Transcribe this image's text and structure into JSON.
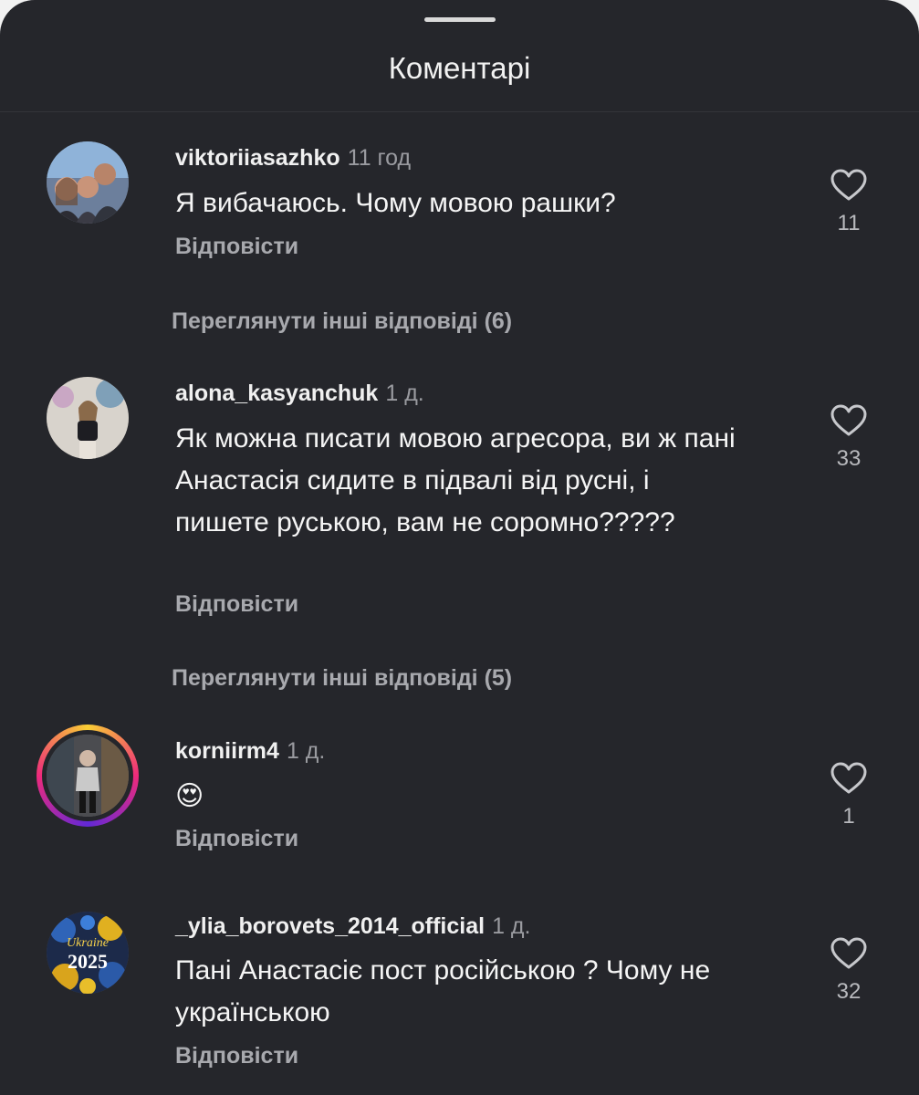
{
  "header": {
    "title": "Коментарі"
  },
  "comments": [
    {
      "username": "viktoriiasazhko",
      "time": "11 год",
      "text": "Я вибачаюсь. Чому мовою рашки?",
      "reply_label": "Відповісти",
      "likes": "11"
    },
    {
      "username": "alona_kasyanchuk",
      "time": "1 д.",
      "text": "Як можна писати мовою агресора, ви ж пані Анастасія сидите в підвалі від русні, і пишете руською, вам не соромно?????",
      "reply_label": "Відповісти",
      "likes": "33"
    },
    {
      "username": "korniirm4",
      "time": "1 д.",
      "text": "😍",
      "reply_label": "Відповісти",
      "likes": "1"
    },
    {
      "username": "_ylia_borovets_2014_official",
      "time": "1 д.",
      "text": "Пані Анастасіє пост російською ? Чому не українською",
      "reply_label": "Відповісти",
      "likes": "32"
    }
  ],
  "more_replies": [
    {
      "label": "Переглянути інші відповіді (6)"
    },
    {
      "label": "Переглянути інші відповіді (5)"
    }
  ],
  "avatars": {
    "c4_label_top": "Ukraine",
    "c4_label_bottom": "2025"
  },
  "icons": {
    "like": "heart-outline-icon",
    "handle": "drag-handle-icon"
  },
  "colors": {
    "background": "#25262b",
    "text": "#f5f5f5",
    "muted": "#a8a9ae"
  }
}
